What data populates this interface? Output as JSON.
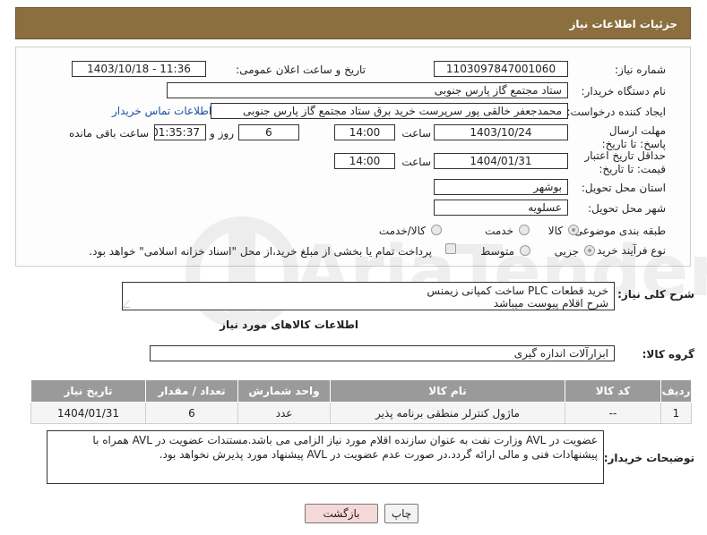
{
  "header": {
    "title": "جزئیات اطلاعات نیاز"
  },
  "fields": {
    "need_number_label": "شماره نیاز:",
    "need_number": "1103097847001060",
    "announce_label": "تاریخ و ساعت اعلان عمومی:",
    "announce_value": "1403/10/18 - 11:36",
    "buyer_org_label": "نام دستگاه خریدار:",
    "buyer_org": "ستاد مجتمع گاز پارس جنوبی",
    "creator_label": "ایجاد کننده درخواست:",
    "creator": "محمدجعفر خالقی پور سرپرست خرید برق ستاد مجتمع گاز پارس جنوبی",
    "contact_link": "اطلاعات تماس خریدار",
    "deadline_label": "مهلت ارسال پاسخ: تا تاریخ:",
    "deadline_date": "1403/10/24",
    "time_label": "ساعت",
    "deadline_time": "14:00",
    "days_value": "6",
    "days_label": "روز و",
    "remaining_value": "01:35:37",
    "remaining_label": "ساعت باقی مانده",
    "validity_label": "حداقل تاریخ اعتبار قیمت: تا تاریخ:",
    "validity_date": "1404/01/31",
    "validity_time": "14:00",
    "province_label": "استان محل تحویل:",
    "province": "بوشهر",
    "city_label": "شهر محل تحویل:",
    "city": "عسلویه",
    "category_label": "طبقه بندی موضوعی:",
    "category_options": [
      "کالا",
      "خدمت",
      "کالا/خدمت"
    ],
    "process_label": "نوع فرآیند خرید :",
    "process_options": [
      "جزیی",
      "متوسط"
    ],
    "payment_note": "پرداخت تمام یا بخشی از مبلغ خرید،از محل \"اسناد خزانه اسلامی\" خواهد بود."
  },
  "description": {
    "label": "شرح کلی نیاز:",
    "line1": "خرید قطعات PLC ساخت کمپانی زیمنس",
    "line2": "شرح اقلام پیوست میباشد"
  },
  "goods": {
    "section_title": "اطلاعات کالاهای مورد نیاز",
    "group_label": "گروه کالا:",
    "group_value": "ابزارآلات اندازه گیری",
    "columns": [
      "ردیف",
      "کد کالا",
      "نام کالا",
      "واحد شمارش",
      "تعداد / مقدار",
      "تاریخ نیاز"
    ],
    "rows": [
      [
        "1",
        "--",
        "ماژول کنترلر منطقی برنامه پذیر",
        "عدد",
        "6",
        "1404/01/31"
      ]
    ]
  },
  "buyer_notes": {
    "label": "توضیحات خریدار:",
    "text": "عضویت در AVL وزارت نفت به عنوان سازنده اقلام مورد نیاز الزامی می باشد.مستندات عضویت در AVL همراه با پیشنهادات فنی و مالی ارائه گردد.در صورت عدم عضویت در AVL پیشنهاد مورد پذیرش نخواهد بود."
  },
  "buttons": {
    "print": "چاپ",
    "back": "بازگشت"
  },
  "watermark": {
    "text": "AriaTender.neT"
  }
}
